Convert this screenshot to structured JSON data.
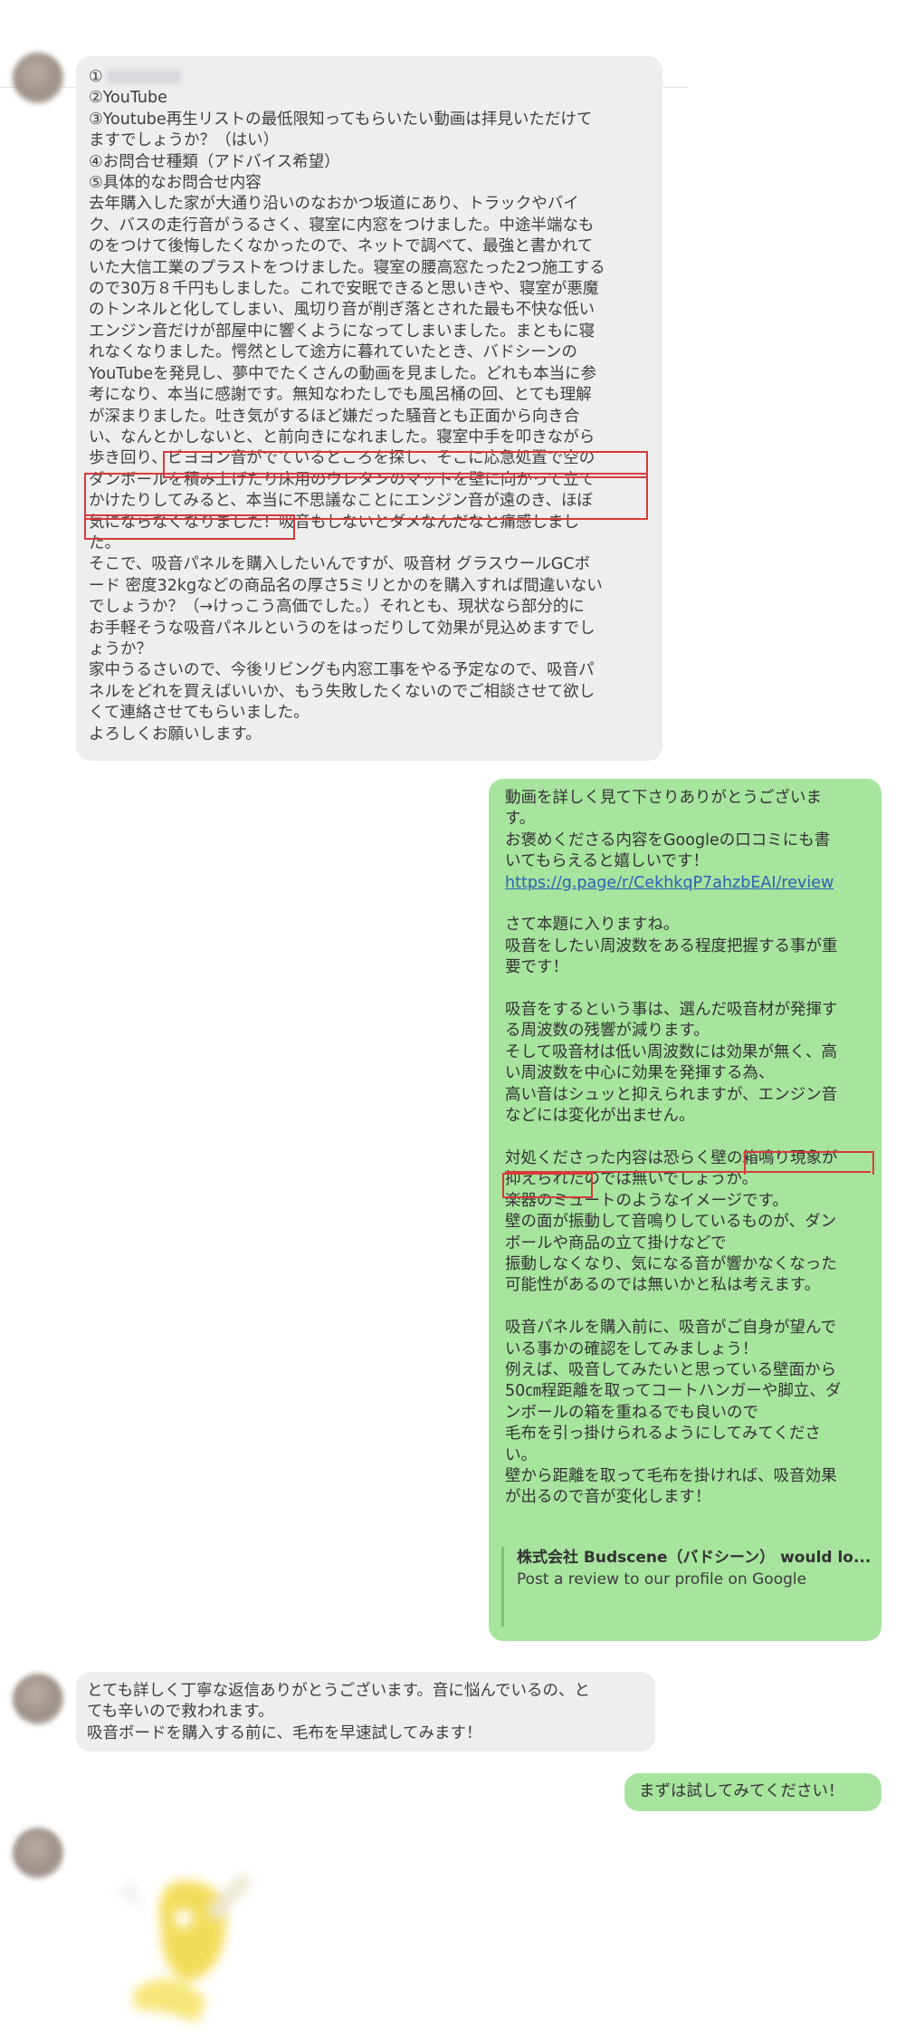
{
  "messages": {
    "inquiry": {
      "lines": [
        "①",
        "②YouTube",
        "③Youtube再生リストの最低限知ってもらいたい動画は拝見いただけて",
        "ますでしょうか？（はい）",
        "④お問合せ種類（アドバイス希望）",
        "⑤具体的なお問合せ内容",
        "去年購入した家が大通り沿いのなおかつ坂道にあり、トラックやバイ",
        "ク、バスの走行音がうるさく、寝室に内窓をつけました。中途半端なも",
        "のをつけて後悔したくなかったので、ネットで調べて、最強と書かれて",
        "いた大信工業のプラストをつけました。寝室の腰高窓たった2つ施工する",
        "ので30万８千円もしました。これで安眠できると思いきや、寝室が悪魔",
        "のトンネルと化してしまい、風切り音が削ぎ落とされた最も不快な低い",
        "エンジン音だけが部屋中に響くようになってしまいました。まともに寝",
        "れなくなりました。愕然として途方に暮れていたとき、バドシーンの",
        "YouTubeを発見し、夢中でたくさんの動画を見ました。どれも本当に参",
        "考になり、本当に感謝です。無知なわたしでも風呂桶の回、とても理解",
        "が深まりました。吐き気がするほど嫌だった騒音とも正面から向き合",
        "い、なんとかしないと、と前向きになれました。寝室中手を叩きながら",
        "歩き回り、ビヨヨン音がでているところを探し、そこに応急処置で空の",
        "ダンボールを積み上げたり床用のウレタンのマットを壁に向かって立て",
        "かけたりしてみると、本当に不思議なことにエンジン音が遠のき、ほぼ",
        "気にならなくなりました！吸音もしないとダメなんだなと痛感しまし",
        "た。",
        "そこで、吸音パネルを購入したいんですが、吸音材 グラスウールGCボ",
        "ード 密度32kgなどの商品名の厚さ5ミリとかのを購入すれば間違いない",
        "でしょうか？（→けっこう高価でした。）それとも、現状なら部分的に",
        "お手軽そうな吸音パネルというのをはっだりして効果が見込めますでし",
        "ょうか？",
        "家中うるさいので、今後リビングも内窓工事をやる予定なので、吸音パ",
        "ネルをどれを買えばいいか、もう失敗したくないのでご相談させて欲し",
        "くて連絡させてもらいました。",
        "よろしくお願いします。"
      ]
    },
    "reply": {
      "lines": [
        "動画を詳しく見て下さりありがとうございま",
        "す。",
        "お褒めくださる内容をGoogleの口コミにも書",
        "いてもらえると嬉しいです！",
        "https://g.page/r/CekhkqP7ahzbEAI/review",
        "",
        "さて本題に入りますね。",
        "吸音をしたい周波数をある程度把握する事が重",
        "要です！",
        "",
        "吸音をするという事は、選んだ吸音材が発揮す",
        "る周波数の残響が減ります。",
        "そして吸音材は低い周波数には効果が無く、高",
        "い周波数を中心に効果を発揮する為、",
        "高い音はシュッと抑えられますが、エンジン音",
        "などには変化が出ません。",
        "",
        "対処くださった内容は恐らく壁の箱鳴り現象が",
        "抑えられたのでは無いでしょうか。",
        "楽器のミュートのようなイメージです。",
        "壁の面が振動して音鳴りしているものが、ダン",
        "ボールや商品の立て掛けなどで",
        "振動しなくなり、気になる音が響かなくなった",
        "可能性があるのでは無いかと私は考えます。",
        "",
        "吸音パネルを購入前に、吸音がご自身が望んで",
        "いる事かの確認をしてみましょう！",
        "例えば、吸音してみたいと思っている壁面から",
        "50㎝程距離を取ってコートハンガーや脚立、ダ",
        "ンボールの箱を重ねるでも良いので",
        "毛布を引っ掛けられるようにしてみてくださ",
        "い。",
        "壁から距離を取って毛布を掛ければ、吸音効果",
        "が出るので音が変化します！"
      ],
      "preview_title": "株式会社 Budscene（バドシーン） would lo...",
      "preview_desc": "Post a review to our profile on Google"
    },
    "thanks": {
      "lines": [
        "とても詳しく丁寧な返信ありがとうございます。音に悩んでいるの、と",
        "ても辛いので救われます。",
        "吸音ボードを購入する前に、毛布を早速試してみます！"
      ]
    },
    "final": {
      "text": "まずは試してみてください！"
    }
  },
  "colors": {
    "incoming_bubble": "#eeeeef",
    "outgoing_bubble": "#a7e49e",
    "highlight": "#d63a3a",
    "link": "#2b62b8"
  }
}
